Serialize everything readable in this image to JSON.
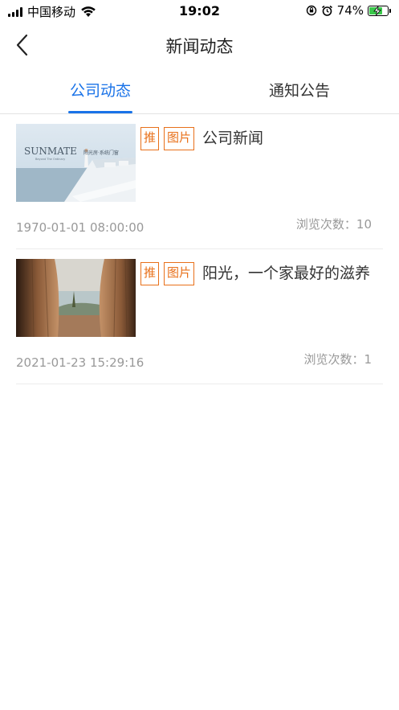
{
  "status_bar": {
    "carrier": "中国移动",
    "time": "19:02",
    "battery": "74%"
  },
  "nav": {
    "title": "新闻动态"
  },
  "tabs": [
    {
      "label": "公司动态",
      "active": true
    },
    {
      "label": "通知公告",
      "active": false
    }
  ],
  "news": [
    {
      "badges": [
        "推",
        "图片"
      ],
      "title": "公司新闻",
      "date": "1970-01-01 08:00:00",
      "views": "浏览次数：10",
      "thumb_brand": "SUNMATE",
      "thumb_sub": "阳光房·系统门窗",
      "thumb_tag": "Beyond The Ordinary"
    },
    {
      "badges": [
        "推",
        "图片"
      ],
      "title": "阳光，一个家最好的滋养",
      "date": "2021-01-23 15:29:16",
      "views": "浏览次数：1"
    }
  ],
  "colors": {
    "accent": "#1a73e8",
    "badge": "#e8701a"
  }
}
